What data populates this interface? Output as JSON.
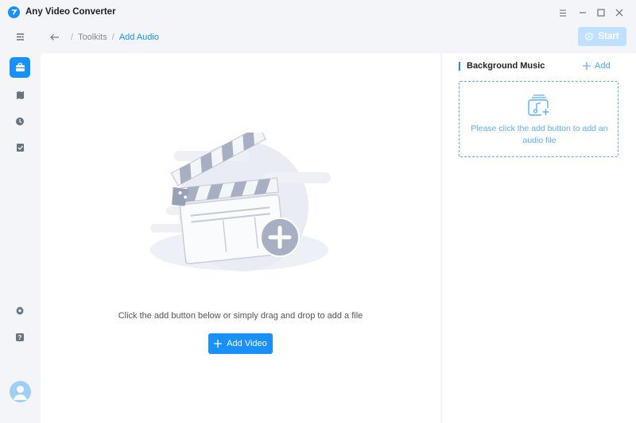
{
  "app": {
    "title": "Any Video Converter"
  },
  "breadcrumb": {
    "root": "Toolkits",
    "current": "Add Audio"
  },
  "toolbar": {
    "start_label": "Start"
  },
  "main": {
    "hint": "Click the add button below or simply drag and drop to add a file",
    "add_video_label": "Add Video"
  },
  "background_music": {
    "title": "Background Music",
    "add_label": "Add",
    "empty_text": "Please click the add button to add an audio file"
  },
  "colors": {
    "accent": "#1890ff",
    "accent_disabled": "#bfe0ff"
  }
}
